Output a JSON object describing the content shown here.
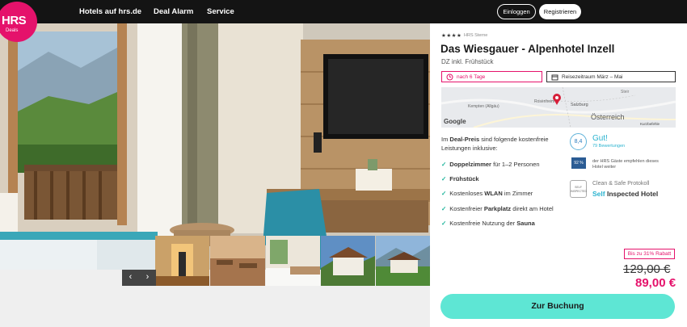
{
  "nav": {
    "items": [
      "Hotels auf hrs.de",
      "Deal Alarm",
      "Service"
    ],
    "login": "Einloggen",
    "register": "Registrieren"
  },
  "logo": {
    "brand": "HRS",
    "sub": "Deals"
  },
  "gallery": {
    "prev_icon": "chevron-left-icon",
    "next_icon": "chevron-right-icon",
    "prev_label": "‹",
    "next_label": "›"
  },
  "hotel": {
    "stars": "★★★★",
    "stars_label": "HRS Sterne",
    "name": "Das Wiesgauer - Alpenhotel Inzell",
    "room": "DZ inkl. Frühstück",
    "nights": "nach 6 Tage",
    "period": "Reisezeitraum März – Mai"
  },
  "map": {
    "places": [
      "Kempten (Allgäu)",
      "Rosenheim",
      "Salzburg",
      "Steir",
      "Österreich",
      "Google",
      "Kurzbefehle"
    ]
  },
  "intro": {
    "prefix": "Im ",
    "highlight": "Deal-Preis",
    "suffix": " sind folgende kostenfreie Leistungen inklusive:"
  },
  "features": [
    {
      "pre": "",
      "bold": "Doppelzimmer",
      "post": " für 1–2 Personen"
    },
    {
      "pre": "",
      "bold": "Frühstück",
      "post": ""
    },
    {
      "pre": "Kostenloses ",
      "bold": "WLAN",
      "post": " im Zimmer"
    },
    {
      "pre": "Kostenfreier ",
      "bold": "Parkplatz",
      "post": " direkt am Hotel"
    },
    {
      "pre": "Kostenfreie Nutzung der ",
      "bold": "Sauna",
      "post": ""
    }
  ],
  "rating": {
    "score": "8,4",
    "word": "Gut!",
    "count": "79 Bewertungen",
    "recommend_pct": "92 %",
    "recommend_text": "der HRS Gäste empfehlen dieses Hotel weiter"
  },
  "clean": {
    "badge": "SELF INSPECTED",
    "title": "Clean & Safe Protokoll",
    "self": "Self",
    "rest": " Inspected Hotel"
  },
  "price": {
    "discount": "Bis zu 31% Rabatt",
    "old": "129,00 €",
    "new": "89,00 €"
  },
  "cta": "Zur Buchung",
  "colors": {
    "brand": "#e5126b",
    "cta": "#5ee6d4",
    "check": "#1bb39a",
    "accent": "#2ab3cf"
  }
}
